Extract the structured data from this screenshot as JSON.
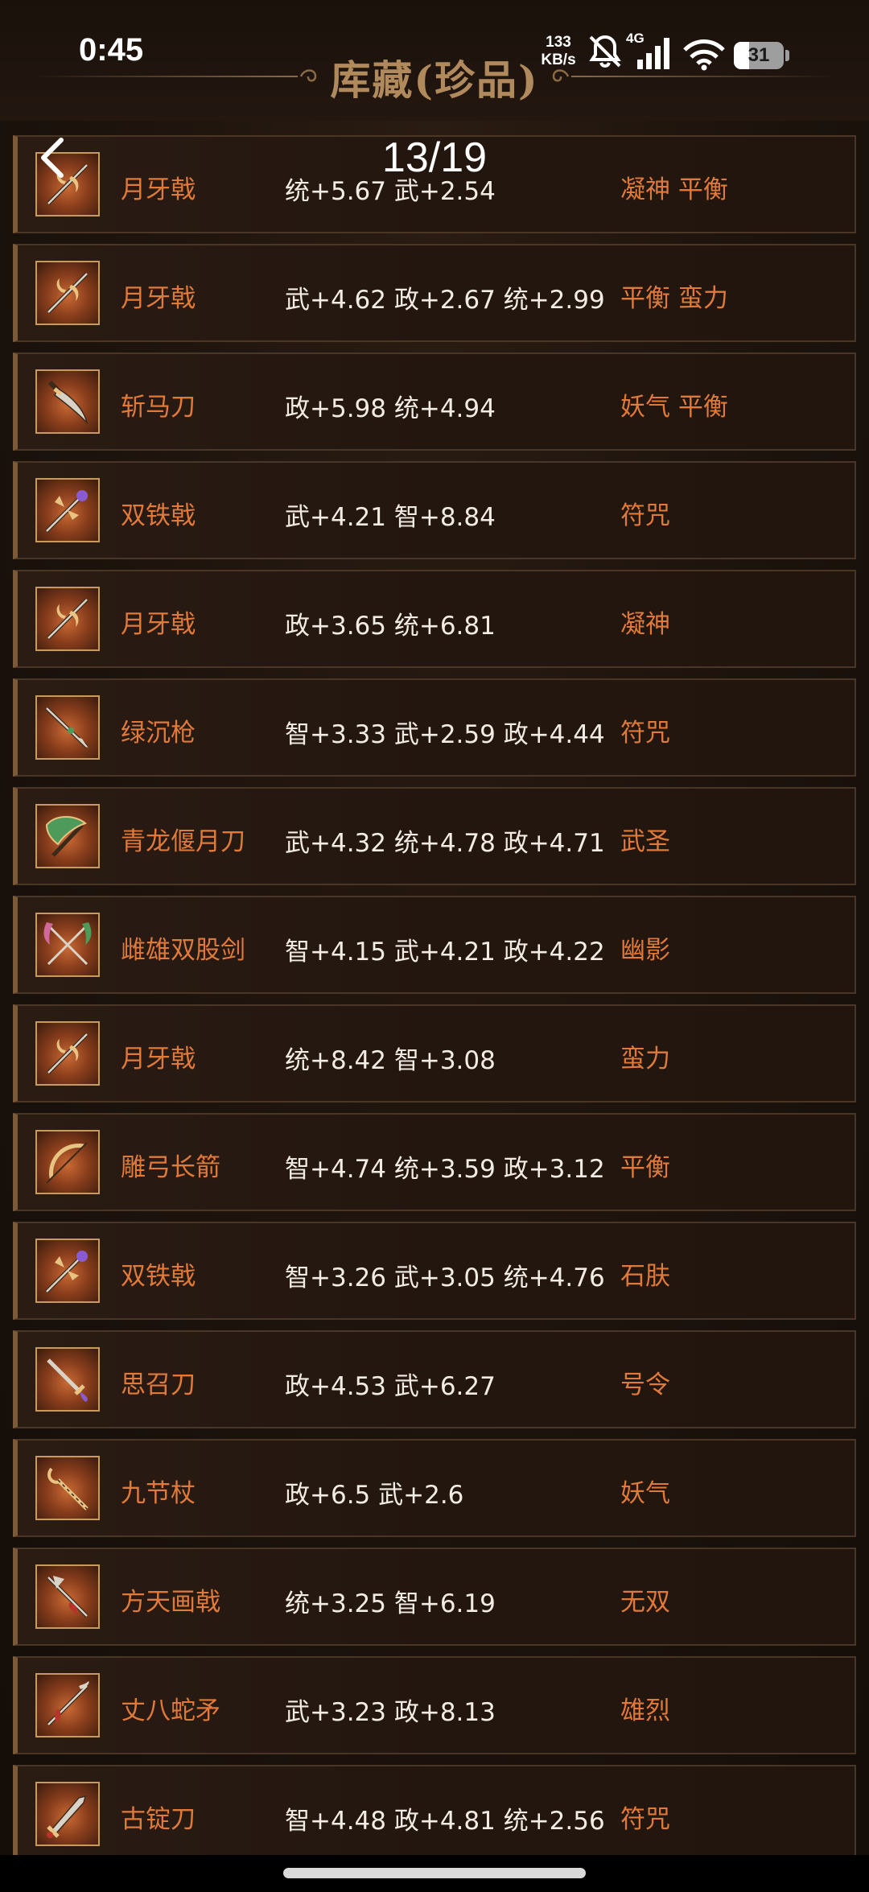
{
  "status": {
    "time": "0:45",
    "net_speed_value": "133",
    "net_speed_unit": "KB/s",
    "network_type": "4G",
    "battery_level": "31",
    "battery_fraction": 0.31
  },
  "header": {
    "title": "库藏(珍品)",
    "scroll_position": "13/19"
  },
  "items": [
    {
      "name": "月牙戟",
      "stats": "统+5.67 武+2.54",
      "traits": "凝神 平衡",
      "icon": "halberd-icon"
    },
    {
      "name": "月牙戟",
      "stats": "武+4.62 政+2.67 统+2.99",
      "traits": "平衡 蛮力",
      "icon": "halberd-icon"
    },
    {
      "name": "斩马刀",
      "stats": "政+5.98 统+4.94",
      "traits": "妖气 平衡",
      "icon": "saber-icon"
    },
    {
      "name": "双铁戟",
      "stats": "武+4.21 智+8.84",
      "traits": "符咒",
      "icon": "twin-halberd-icon"
    },
    {
      "name": "月牙戟",
      "stats": "政+3.65 统+6.81",
      "traits": "凝神",
      "icon": "halberd-icon"
    },
    {
      "name": "绿沉枪",
      "stats": "智+3.33 武+2.59 政+4.44",
      "traits": "符咒",
      "icon": "spear-icon"
    },
    {
      "name": "青龙偃月刀",
      "stats": "武+4.32 统+4.78 政+4.71",
      "traits": "武圣",
      "icon": "glaive-icon"
    },
    {
      "name": "雌雄双股剑",
      "stats": "智+4.15 武+4.21 政+4.22",
      "traits": "幽影",
      "icon": "twin-swords-icon"
    },
    {
      "name": "月牙戟",
      "stats": "统+8.42 智+3.08",
      "traits": "蛮力",
      "icon": "halberd-icon"
    },
    {
      "name": "雕弓长箭",
      "stats": "智+4.74 统+3.59 政+3.12",
      "traits": "平衡",
      "icon": "bow-icon"
    },
    {
      "name": "双铁戟",
      "stats": "智+3.26 武+3.05 统+4.76",
      "traits": "石肤",
      "icon": "twin-halberd-icon"
    },
    {
      "name": "思召刀",
      "stats": "政+4.53 武+6.27",
      "traits": "号令",
      "icon": "sword-icon"
    },
    {
      "name": "九节杖",
      "stats": "政+6.5 武+2.6",
      "traits": "妖气",
      "icon": "staff-icon"
    },
    {
      "name": "方天画戟",
      "stats": "统+3.25 智+6.19",
      "traits": "无双",
      "icon": "sky-halberd-icon"
    },
    {
      "name": "丈八蛇矛",
      "stats": "武+3.23 政+8.13",
      "traits": "雄烈",
      "icon": "serpent-spear-icon"
    },
    {
      "name": "古锭刀",
      "stats": "智+4.48 政+4.81 统+2.56",
      "traits": "符咒",
      "icon": "broadsword-icon"
    }
  ],
  "colors": {
    "name_text": "#e07a3a",
    "stats_text": "#f2ece4",
    "title_text": "#b08a5c",
    "row_border": "#4a3626",
    "icon_frame": "#c89a5e"
  }
}
